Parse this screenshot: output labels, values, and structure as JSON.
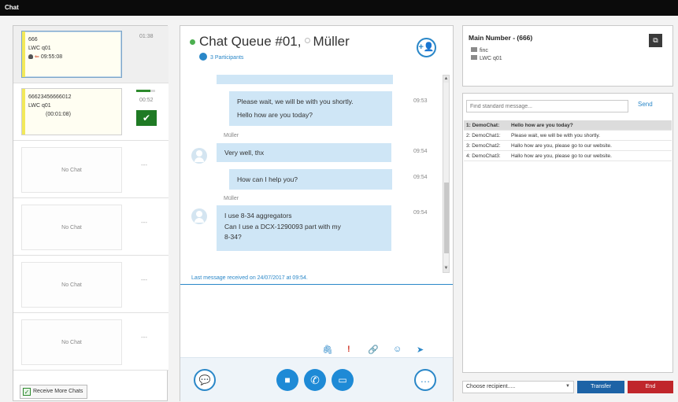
{
  "window": {
    "title": "Chat"
  },
  "queue": {
    "slots": [
      {
        "line1": "666",
        "line2": "LWC q01",
        "line3": "09:55:08",
        "time": "01:38"
      },
      {
        "line1": "66623456666012",
        "line2": "LWC q01",
        "line3": "(00:01:08)",
        "time": "00:52",
        "progress": 0.75
      },
      {
        "empty_label": "No Chat",
        "time": "---"
      },
      {
        "empty_label": "No Chat",
        "time": "---"
      },
      {
        "empty_label": "No Chat",
        "time": "---"
      },
      {
        "empty_label": "No Chat",
        "time": "---"
      }
    ],
    "receive_more_label": "Receive More Chats"
  },
  "chat": {
    "title": "Chat Queue #01,",
    "participant_name": "Müller",
    "participants_label": "3 Participants",
    "messages": [
      {
        "text": "Please wait, we will be with you shortly.",
        "time": "09:53"
      },
      {
        "text": "Hello how are you today?"
      },
      {
        "sender": "Müller",
        "text": "Very well, thx",
        "time": "09:54"
      },
      {
        "text": "How can I help you?",
        "time": "09:54"
      },
      {
        "sender": "Müller",
        "text": "I use 8-34 aggregators",
        "time": "09:54"
      },
      {
        "text": "Can I use a DCX-1290093 part with my"
      },
      {
        "text": "8-34?"
      }
    ],
    "last_message_label": "Last message received on 24/07/2017 at 09:54."
  },
  "info": {
    "title": "Main Number - (666)",
    "line1": "finc",
    "line2": "LWC q01"
  },
  "standard_messages": {
    "search_placeholder": "Find standard message...",
    "send_label": "Send",
    "rows": [
      {
        "key": "1: DemoChat:",
        "text": "Hello how are you today?"
      },
      {
        "key": "2: DemoChat1:",
        "text": "Please wait, we will be with you shortly."
      },
      {
        "key": "3: DemoChat2:",
        "text": "Hallo how are you, please go to our website."
      },
      {
        "key": "4: DemoChat3:",
        "text": "Hallo how are you, please go to our website."
      }
    ]
  },
  "footer": {
    "recipient_placeholder": "Choose recipient.....",
    "transfer_label": "Transfer",
    "end_label": "End"
  },
  "colors": {
    "accent": "#1e8ad6",
    "end": "#c0262b",
    "transfer": "#1d63a6",
    "accept": "#1f7a24"
  }
}
